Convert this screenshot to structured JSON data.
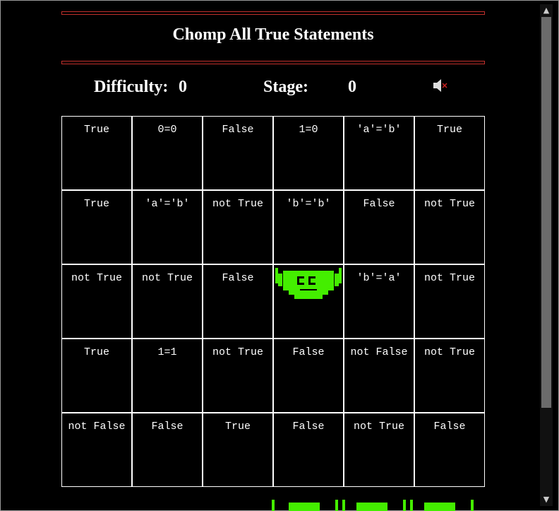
{
  "game": {
    "title": "Chomp All True Statements",
    "difficulty_label": "Difficulty:",
    "difficulty_value": "0",
    "stage_label": "Stage:",
    "stage_value": "0",
    "sound_icon": "speaker-muted-icon",
    "player_position": {
      "row": 2,
      "col": 3
    }
  },
  "colors": {
    "background": "#000000",
    "text": "#ffffff",
    "banner_border": "#c0302c",
    "muncher": "#44ee00",
    "mute_x": "#cc2222"
  },
  "grid": {
    "rows": [
      [
        "True",
        "0=0",
        "False",
        "1=0",
        "'a'='b'",
        "True"
      ],
      [
        "True",
        "'a'='b'",
        "not True",
        "'b'='b'",
        "False",
        "not True"
      ],
      [
        "not True",
        "not True",
        "False",
        "",
        "'b'='a'",
        "not True"
      ],
      [
        "True",
        "1=1",
        "not True",
        "False",
        "not False",
        "not True"
      ],
      [
        "not False",
        "False",
        "True",
        "False",
        "not True",
        "False"
      ]
    ]
  },
  "scrollbar": {
    "up_icon": "arrow-up-icon",
    "down_icon": "arrow-down-icon"
  }
}
